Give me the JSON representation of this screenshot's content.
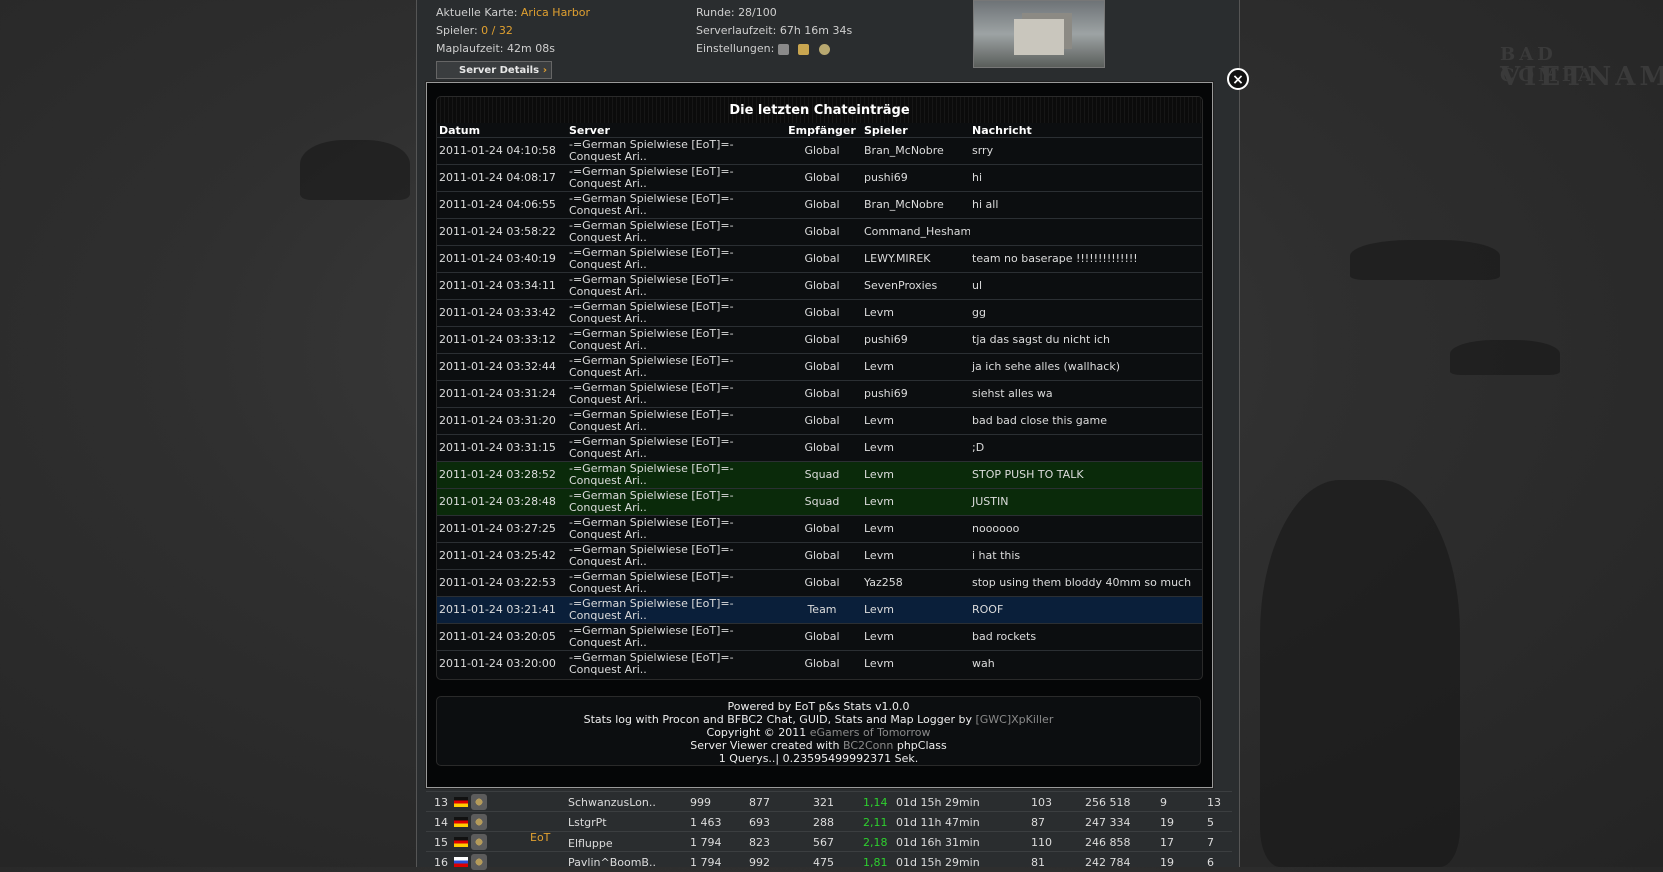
{
  "server_info": {
    "map_label": "Aktuelle Karte:",
    "map_value": "Arica Harbor",
    "players_label": "Spieler:",
    "players_value": "0 / 32",
    "maptime_label": "Maplaufzeit:",
    "maptime_value": "42m 08s",
    "round_label": "Runde:",
    "round_value": "28/100",
    "uptime_label": "Serverlaufzeit:",
    "uptime_value": "67h 16m 34s",
    "settings_label": "Einstellungen:",
    "details_button": "Server Details"
  },
  "background_text": {
    "line1": "BAD COMPA",
    "line2": "VIETNAM"
  },
  "modal": {
    "close_symbol": "×",
    "title": "Die letzten Chateinträge",
    "columns": [
      "Datum",
      "Server",
      "Empfänger",
      "Spieler",
      "Nachricht"
    ],
    "rows": [
      {
        "date": "2011-01-24 04:10:58",
        "server": "-=German Spielwiese [EoT]=- Conquest Ari..",
        "recv": "Global",
        "player": "Bran_McNobre",
        "msg": "srry",
        "type": "global"
      },
      {
        "date": "2011-01-24 04:08:17",
        "server": "-=German Spielwiese [EoT]=- Conquest Ari..",
        "recv": "Global",
        "player": "pushi69",
        "msg": "hi",
        "type": "global"
      },
      {
        "date": "2011-01-24 04:06:55",
        "server": "-=German Spielwiese [EoT]=- Conquest Ari..",
        "recv": "Global",
        "player": "Bran_McNobre",
        "msg": "hi all",
        "type": "global"
      },
      {
        "date": "2011-01-24 03:58:22",
        "server": "-=German Spielwiese [EoT]=- Conquest Ari..",
        "recv": "Global",
        "player": "Command_Heshamgg\\",
        "msg": "",
        "type": "global"
      },
      {
        "date": "2011-01-24 03:40:19",
        "server": "-=German Spielwiese [EoT]=- Conquest Ari..",
        "recv": "Global",
        "player": "LEWY.MIREK",
        "msg": "team no baserape !!!!!!!!!!!!!!",
        "type": "global"
      },
      {
        "date": "2011-01-24 03:34:11",
        "server": "-=German Spielwiese [EoT]=- Conquest Ari..",
        "recv": "Global",
        "player": "SevenProxies",
        "msg": "ul",
        "type": "global"
      },
      {
        "date": "2011-01-24 03:33:42",
        "server": "-=German Spielwiese [EoT]=- Conquest Ari..",
        "recv": "Global",
        "player": "Levm",
        "msg": "gg",
        "type": "global"
      },
      {
        "date": "2011-01-24 03:33:12",
        "server": "-=German Spielwiese [EoT]=- Conquest Ari..",
        "recv": "Global",
        "player": "pushi69",
        "msg": "tja das sagst du nicht ich",
        "type": "global"
      },
      {
        "date": "2011-01-24 03:32:44",
        "server": "-=German Spielwiese [EoT]=- Conquest Ari..",
        "recv": "Global",
        "player": "Levm",
        "msg": "ja ich sehe alles (wallhack)",
        "type": "global"
      },
      {
        "date": "2011-01-24 03:31:24",
        "server": "-=German Spielwiese [EoT]=- Conquest Ari..",
        "recv": "Global",
        "player": "pushi69",
        "msg": "siehst alles wa",
        "type": "global"
      },
      {
        "date": "2011-01-24 03:31:20",
        "server": "-=German Spielwiese [EoT]=- Conquest Ari..",
        "recv": "Global",
        "player": "Levm",
        "msg": "bad bad close this game",
        "type": "global"
      },
      {
        "date": "2011-01-24 03:31:15",
        "server": "-=German Spielwiese [EoT]=- Conquest Ari..",
        "recv": "Global",
        "player": "Levm",
        "msg": ";D",
        "type": "global"
      },
      {
        "date": "2011-01-24 03:28:52",
        "server": "-=German Spielwiese [EoT]=- Conquest Ari..",
        "recv": "Squad",
        "player": "Levm",
        "msg": "STOP PUSH TO TALK",
        "type": "squad"
      },
      {
        "date": "2011-01-24 03:28:48",
        "server": "-=German Spielwiese [EoT]=- Conquest Ari..",
        "recv": "Squad",
        "player": "Levm",
        "msg": "JUSTIN",
        "type": "squad"
      },
      {
        "date": "2011-01-24 03:27:25",
        "server": "-=German Spielwiese [EoT]=- Conquest Ari..",
        "recv": "Global",
        "player": "Levm",
        "msg": "noooooo",
        "type": "global"
      },
      {
        "date": "2011-01-24 03:25:42",
        "server": "-=German Spielwiese [EoT]=- Conquest Ari..",
        "recv": "Global",
        "player": "Levm",
        "msg": "i hat this",
        "type": "global"
      },
      {
        "date": "2011-01-24 03:22:53",
        "server": "-=German Spielwiese [EoT]=- Conquest Ari..",
        "recv": "Global",
        "player": "Yaz258",
        "msg": "stop using them bloddy 40mm so much",
        "type": "global"
      },
      {
        "date": "2011-01-24 03:21:41",
        "server": "-=German Spielwiese [EoT]=- Conquest Ari..",
        "recv": "Team",
        "player": "Levm",
        "msg": "ROOF",
        "type": "team"
      },
      {
        "date": "2011-01-24 03:20:05",
        "server": "-=German Spielwiese [EoT]=- Conquest Ari..",
        "recv": "Global",
        "player": "Levm",
        "msg": "bad rockets",
        "type": "global"
      },
      {
        "date": "2011-01-24 03:20:00",
        "server": "-=German Spielwiese [EoT]=- Conquest Ari..",
        "recv": "Global",
        "player": "Levm",
        "msg": "wah",
        "type": "global"
      }
    ],
    "footer": {
      "line1": "Powered by EoT p&s Stats v1.0.0",
      "line2_pre": "Stats log with Procon and BFBC2 Chat, GUID, Stats and Map Logger by ",
      "line2_link": "[GWC]XpKiller",
      "line3_pre": "Copyright © 2011 ",
      "line3_link": "eGamers of Tomorrow",
      "line4_pre": "Server Viewer created with ",
      "line4_link": "BC2Conn",
      "line4_post": " phpClass",
      "line5": "1 Querys..| 0.23595499992371 Sek."
    }
  },
  "scoreboard": {
    "rows": [
      {
        "rank": "13",
        "flag": "de",
        "tag": "",
        "name": "SchwanzusLon..",
        "c1": "999",
        "c2": "877",
        "c3": "321",
        "kd": "1,14",
        "time": "01d 15h 29min",
        "c6": "103",
        "score": "256 518",
        "c8": "9",
        "c9": "13"
      },
      {
        "rank": "14",
        "flag": "de",
        "tag": "",
        "name": "LstgrPt",
        "c1": "1 463",
        "c2": "693",
        "c3": "288",
        "kd": "2,11",
        "time": "01d 11h 47min",
        "c6": "87",
        "score": "247 334",
        "c8": "19",
        "c9": "5"
      },
      {
        "rank": "15",
        "flag": "de",
        "tag": "EoT",
        "name": "Elfluppe",
        "c1": "1 794",
        "c2": "823",
        "c3": "567",
        "kd": "2,18",
        "time": "01d 16h 31min",
        "c6": "110",
        "score": "246 858",
        "c8": "17",
        "c9": "7"
      },
      {
        "rank": "16",
        "flag": "ru",
        "tag": "",
        "name": "Pavlin^BoomB..",
        "c1": "1 794",
        "c2": "992",
        "c3": "475",
        "kd": "1,81",
        "time": "01d 15h 29min",
        "c6": "81",
        "score": "242 784",
        "c8": "19",
        "c9": "6"
      }
    ]
  }
}
